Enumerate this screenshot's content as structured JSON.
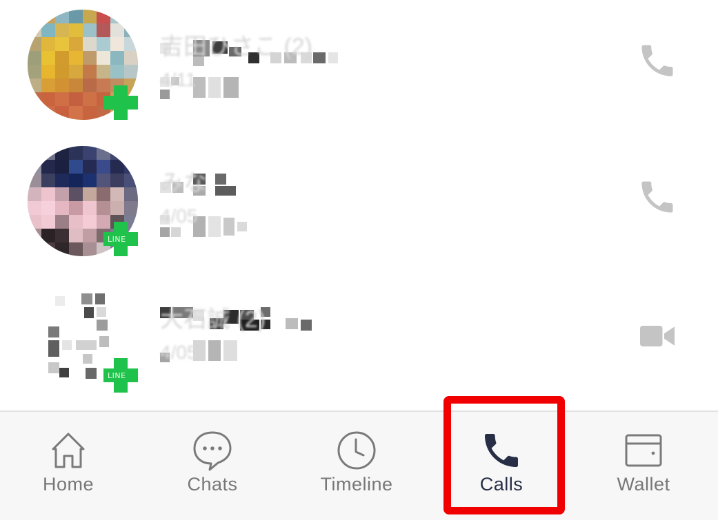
{
  "colors": {
    "accent_active": "#272e45",
    "tab_inactive": "#777777",
    "call_icon": "#c4c4c4",
    "line_green": "#1fc24a",
    "highlight": "#f00000"
  },
  "call_history": [
    {
      "name": "吉田ひさこ (2)",
      "date": "4/11",
      "call_type_icon": "phone-icon",
      "badge": ""
    },
    {
      "name": "みな",
      "date": "4/05",
      "call_type_icon": "phone-icon",
      "badge": "LINE"
    },
    {
      "name": "大石誠 (2)",
      "date": "4/05",
      "call_type_icon": "video-camera-icon",
      "badge": "LINE"
    }
  ],
  "tab_bar": {
    "active_index": 3,
    "tabs": [
      {
        "label": "Home",
        "icon": "home-icon"
      },
      {
        "label": "Chats",
        "icon": "chat-bubble-icon"
      },
      {
        "label": "Timeline",
        "icon": "clock-icon"
      },
      {
        "label": "Calls",
        "icon": "phone-icon"
      },
      {
        "label": "Wallet",
        "icon": "wallet-icon"
      }
    ]
  }
}
